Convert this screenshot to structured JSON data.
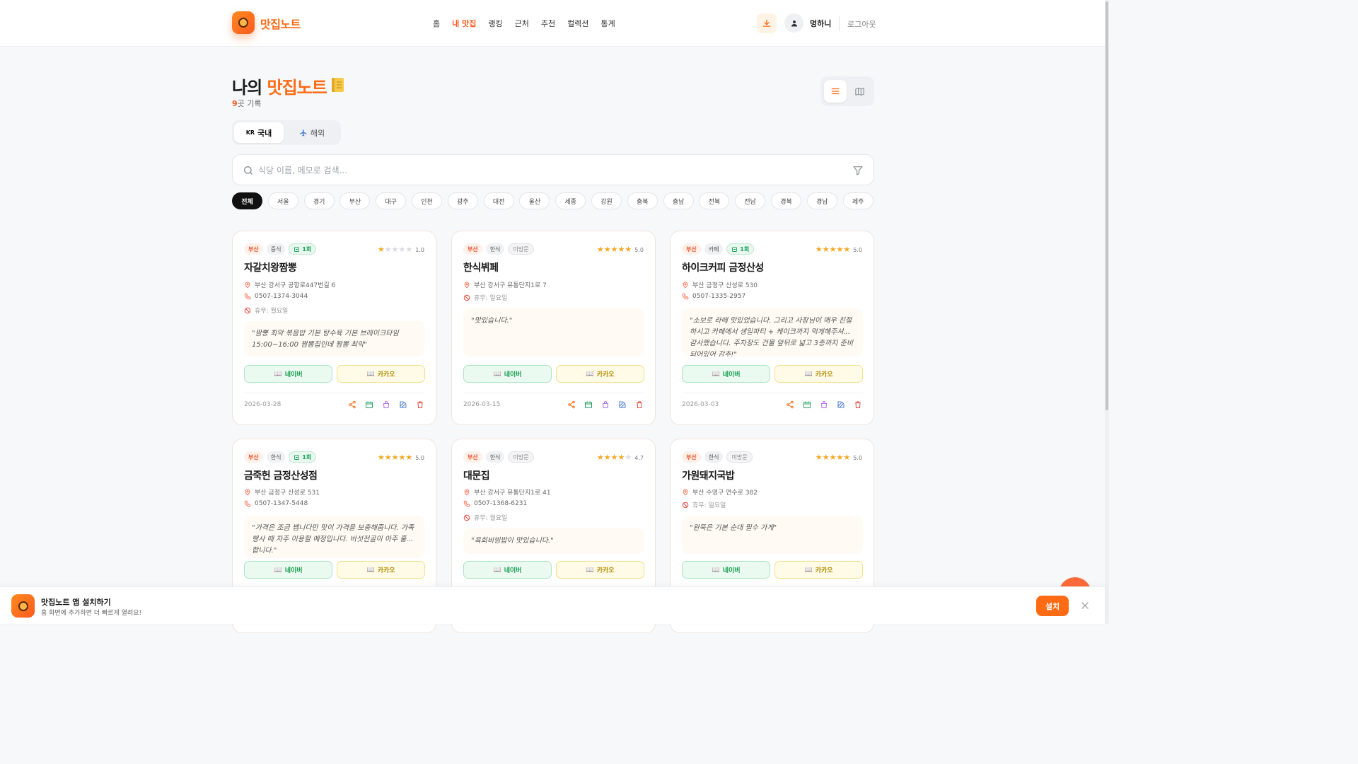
{
  "header": {
    "logo_text": "맛집노트",
    "nav": [
      "홈",
      "내 맛집",
      "랭킹",
      "근처",
      "추천",
      "컬렉션",
      "통계"
    ],
    "active_nav": "내 맛집",
    "user_name": "멍하니",
    "logout": "로그아웃",
    "accent_color": "#ff6a14"
  },
  "page": {
    "title_prefix": "나의 ",
    "title_highlight": "맛집노트",
    "count_num": "9",
    "count_suffix": "곳 기록"
  },
  "region_tabs": {
    "domestic_flag": "KR",
    "domestic": "국내",
    "overseas_icon": "airplane-icon",
    "overseas": "해외"
  },
  "search": {
    "placeholder": "식당 이름, 메모로 검색..."
  },
  "chips": [
    "전체",
    "서울",
    "경기",
    "부산",
    "대구",
    "인천",
    "광주",
    "대전",
    "울산",
    "세종",
    "강원",
    "충북",
    "충남",
    "전북",
    "전남",
    "경북",
    "경남",
    "제주"
  ],
  "cards": [
    {
      "region": "부산",
      "category": "중식",
      "visit_label": "1회",
      "visited": true,
      "stars": 1,
      "rating": "1.0",
      "name": "자갈치왕짬뽕",
      "address": "부산 강서구 공항로447번길 6",
      "phone": "0507-1374-3044",
      "holiday": "휴무: 월요일",
      "memo": "\"짬뽕 최악 볶음밥 기본 탕수육 기본 브레이크타임 15:00~16:00 짬뽕집인데 짬뽕 최악\"",
      "naver": "네이버",
      "kakao": "카카오",
      "date": "2026-03-28"
    },
    {
      "region": "부산",
      "category": "한식",
      "visit_label": "미방문",
      "visited": false,
      "stars": 5,
      "rating": "5.0",
      "name": "한식뷔페",
      "address": "부산 강서구 유통단지1로 7",
      "phone": "",
      "holiday": "휴무: 일요일",
      "memo": "\"맛있습니다.\"",
      "naver": "네이버",
      "kakao": "카카오",
      "date": "2026-03-15"
    },
    {
      "region": "부산",
      "category": "카페",
      "visit_label": "1회",
      "visited": true,
      "stars": 5,
      "rating": "5.0",
      "name": "하이크커피 금정산성",
      "address": "부산 금정구 산성로 530",
      "phone": "0507-1335-2957",
      "holiday": "",
      "memo": "\"소보로 라떼 맛있었습니다. 그리고 사장님이 매우 친절하시고 카페에서 생일파티 + 케이크까지 먹게해주셔... 감사했습니다. 주차장도 건물 앞뒤로 넓고 3층까지 준비되어있어 강추!\"",
      "naver": "네이버",
      "kakao": "카카오",
      "date": "2026-03-03"
    },
    {
      "region": "부산",
      "category": "한식",
      "visit_label": "1회",
      "visited": true,
      "stars": 5,
      "rating": "5.0",
      "name": "금죽헌 금정산성점",
      "address": "부산 금정구 산성로 531",
      "phone": "0507-1347-5448",
      "holiday": "",
      "memo": "\"가격은 조금 쎕니다만 맛이 가격을 보충해줍니다. 가족 행사 때 자주 이용할 예정입니다. 버섯전골이 아주 훌... 합니다.\"",
      "naver": "네이버",
      "kakao": "카카오",
      "date": ""
    },
    {
      "region": "부산",
      "category": "한식",
      "visit_label": "미방문",
      "visited": false,
      "stars": 4.7,
      "rating": "4.7",
      "name": "대문집",
      "address": "부산 강서구 유통단지1로 41",
      "phone": "0507-1368-6231",
      "holiday": "휴무: 월요일",
      "memo": "\"육회비빔밥이 맛있습니다.\"",
      "naver": "네이버",
      "kakao": "카카오",
      "date": ""
    },
    {
      "region": "부산",
      "category": "한식",
      "visit_label": "미방문",
      "visited": false,
      "stars": 5,
      "rating": "5.0",
      "name": "가원돼지국밥",
      "address": "부산 수영구 연수로 382",
      "phone": "",
      "holiday": "휴무: 일요일",
      "memo": "\"완뚝은 기본 순대 필수 가게\"",
      "naver": "네이버",
      "kakao": "카카오",
      "date": ""
    }
  ],
  "install": {
    "title": "맛집노트 앱 설치하기",
    "subtitle": "홈 화면에 추가하면 더 빠르게 열려요!",
    "button": "설치"
  }
}
